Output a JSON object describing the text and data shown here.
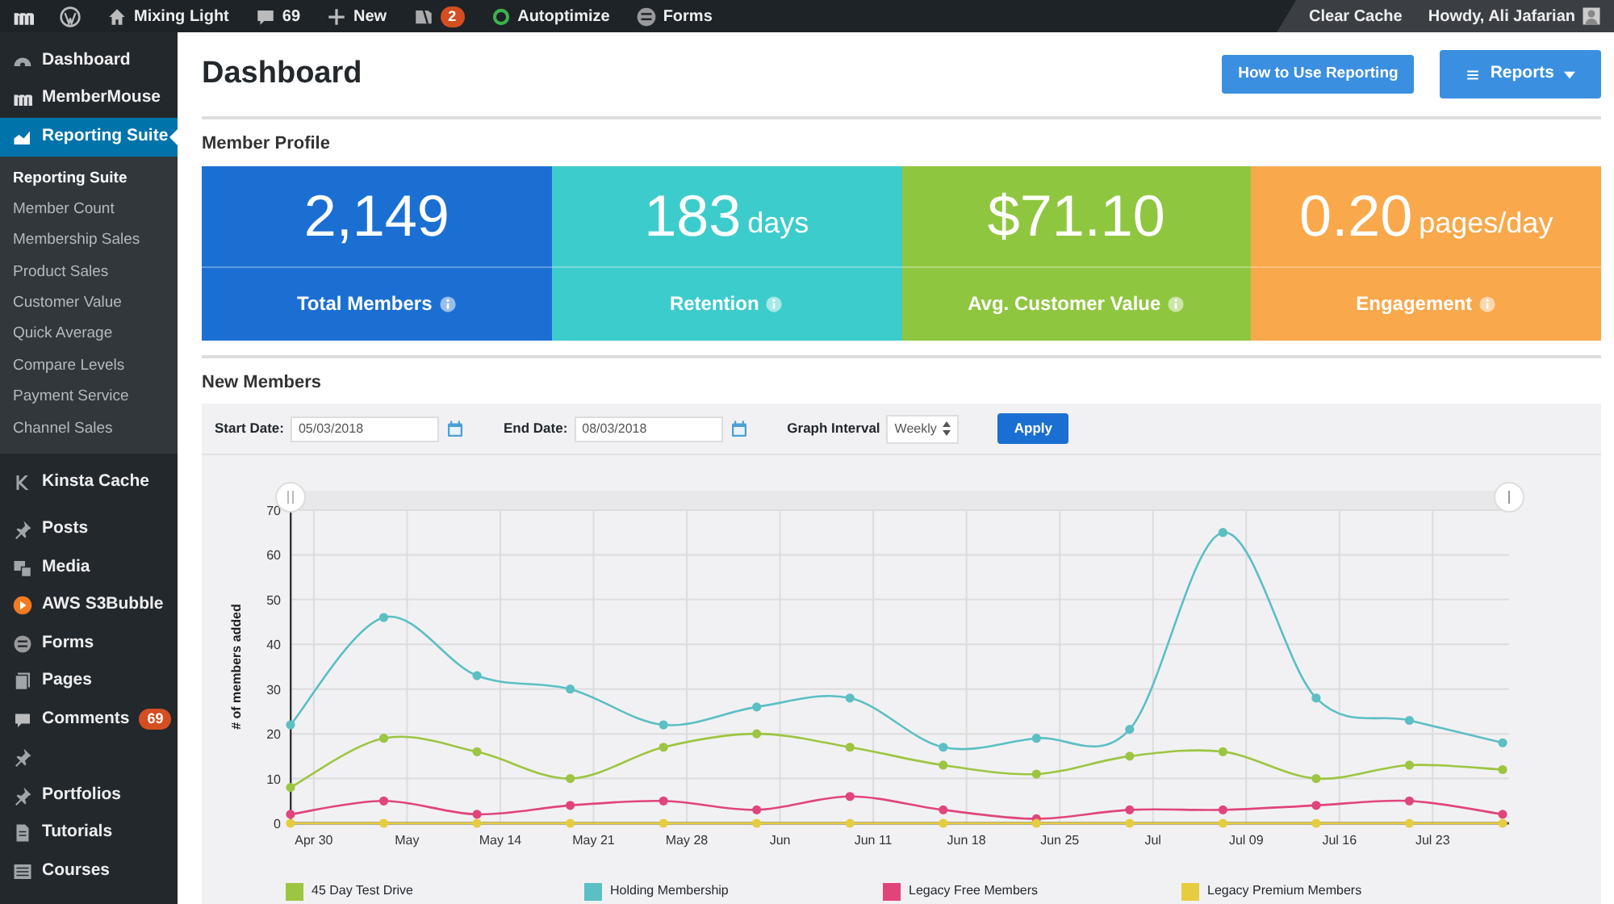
{
  "admin_bar": {
    "site": "Mixing Light",
    "comments": "69",
    "new": "New",
    "updates_badge": "2",
    "autoptimize": "Autoptimize",
    "forms": "Forms",
    "clear_cache": "Clear Cache",
    "greeting": "Howdy, Ali Jafarian"
  },
  "sidebar": {
    "items": [
      {
        "label": "Dashboard",
        "selected": false
      },
      {
        "label": "MemberMouse",
        "selected": false
      },
      {
        "label": "Reporting Suite",
        "selected": true,
        "children": [
          {
            "label": "Reporting Suite",
            "selected": true
          },
          {
            "label": "Member Count",
            "selected": false
          },
          {
            "label": "Membership Sales",
            "selected": false
          },
          {
            "label": "Product Sales",
            "selected": false
          },
          {
            "label": "Customer Value",
            "selected": false
          },
          {
            "label": "Quick Average",
            "selected": false
          },
          {
            "label": "Compare Levels",
            "selected": false
          },
          {
            "label": "Payment Service",
            "selected": false
          },
          {
            "label": "Channel Sales",
            "selected": false
          }
        ]
      },
      {
        "label": "Kinsta Cache",
        "selected": false
      },
      {
        "label": "Posts",
        "selected": false
      },
      {
        "label": "Media",
        "selected": false
      },
      {
        "label": "AWS S3Bubble",
        "selected": false
      },
      {
        "label": "Forms",
        "selected": false
      },
      {
        "label": "Pages",
        "selected": false
      },
      {
        "label": "Comments",
        "selected": false,
        "badge": "69"
      },
      {
        "selected": false
      },
      {
        "label": "Portfolios",
        "selected": false
      },
      {
        "label": "Tutorials",
        "selected": false
      },
      {
        "label": "Courses",
        "selected": false
      }
    ]
  },
  "page": {
    "title": "Dashboard",
    "help_button": "How to Use Reporting",
    "reports_button": "Reports"
  },
  "member_profile": {
    "heading": "Member Profile",
    "stats": [
      {
        "value": "2,149",
        "label": "Total Members",
        "color": "#1b6fd2"
      },
      {
        "value": "183",
        "unit": "days",
        "label": "Retention",
        "color": "#3dcccc"
      },
      {
        "value": "$71.10",
        "label": "Avg. Customer Value",
        "color": "#8fc63f"
      },
      {
        "value": "0.20",
        "unit": "pages/day",
        "label": "Engagement",
        "color": "#f9a84b"
      }
    ]
  },
  "new_members": {
    "heading": "New Members",
    "start_date": {
      "label": "Start Date:",
      "value": "05/03/2018"
    },
    "end_date": {
      "label": "End Date:",
      "value": "08/03/2018"
    },
    "interval": {
      "label": "Graph Interval",
      "value": "Weekly"
    },
    "apply": "Apply",
    "chart_data": {
      "type": "line",
      "ylabel": "# of members added",
      "categories": [
        "Apr 30",
        "May",
        "May 14",
        "May 21",
        "May 28",
        "Jun",
        "Jun 11",
        "Jun 18",
        "Jun 25",
        "Jul",
        "Jul 09",
        "Jul 16",
        "Jul 23",
        null
      ],
      "grid": true,
      "ylim": [
        0,
        70
      ],
      "yticks": [
        0,
        10,
        20,
        30,
        40,
        50,
        60,
        70
      ],
      "series": [
        {
          "name": "45 Day Test Drive",
          "color": "#9cc541",
          "marker": "circle",
          "values": [
            8,
            19,
            16,
            10,
            17,
            20,
            17,
            13,
            11,
            15,
            16,
            10,
            13,
            12
          ]
        },
        {
          "name": "Holding Membership",
          "color": "#5bbfc4",
          "marker": "circle",
          "values": [
            22,
            46,
            33,
            30,
            22,
            26,
            28,
            17,
            19,
            21,
            65,
            28,
            23,
            18
          ]
        },
        {
          "name": "Legacy Free Members",
          "color": "#e0457a",
          "marker": "circle",
          "values": [
            2,
            5,
            2,
            4,
            5,
            3,
            6,
            3,
            1,
            3,
            3,
            4,
            5,
            2
          ]
        },
        {
          "name": "Legacy Premium Members",
          "color": "#e6cc3f",
          "marker": "circle",
          "values": [
            0,
            0,
            0,
            0,
            0,
            0,
            0,
            0,
            0,
            0,
            0,
            0,
            0,
            0
          ]
        }
      ]
    }
  }
}
